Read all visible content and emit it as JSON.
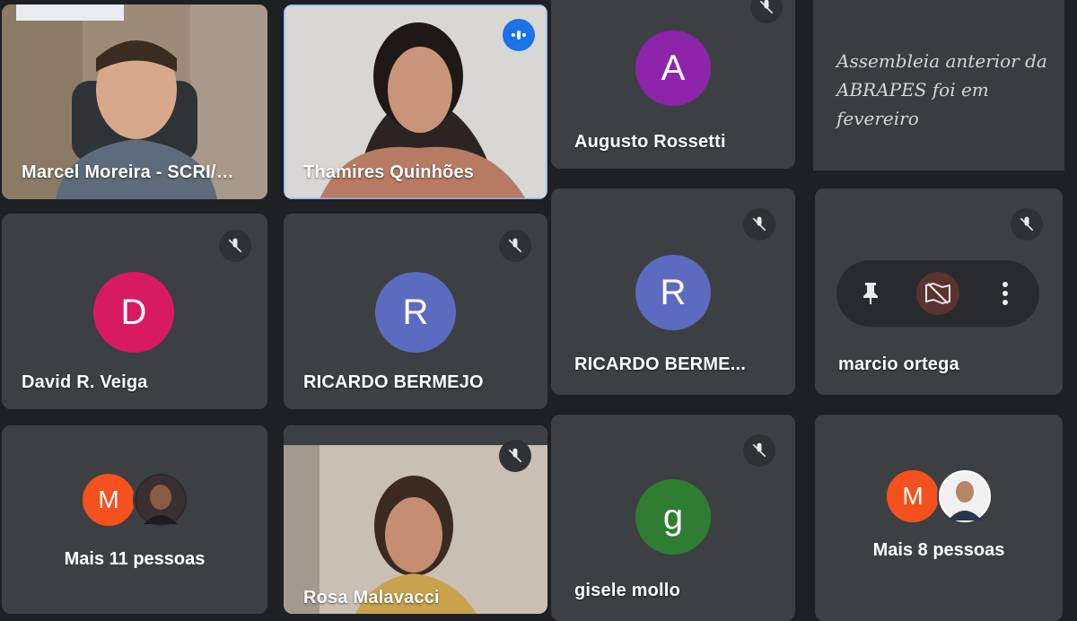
{
  "participants": [
    {
      "name": "Marcel Moreira - SCRI/M...",
      "type": "video"
    },
    {
      "name": "Thamires Quinhões",
      "type": "video",
      "speaking": true
    },
    {
      "name": "Augusto Rossetti",
      "initial": "A",
      "color": "#8e24aa"
    },
    {
      "name": "David R. Veiga",
      "initial": "D",
      "color": "#d81b60"
    },
    {
      "name": "RICARDO BERMEJO",
      "initial": "R",
      "color": "#5c6bc0"
    },
    {
      "name": "RICARDO BERME...",
      "initial": "R",
      "color": "#5c6bc0"
    },
    {
      "name": "marcio ortega"
    },
    {
      "name": "Rosa Malavacci",
      "type": "video"
    },
    {
      "name": "gisele mollo",
      "initial": "g",
      "color": "#2e7d32"
    }
  ],
  "others": [
    {
      "label": "Mais 11 pessoas",
      "initial": "M",
      "color": "#f4511e"
    },
    {
      "label": "Mais 8 pessoas",
      "initial": "M",
      "color": "#f4511e"
    }
  ],
  "caption": "Assembleia anterior da ABRAPES foi em fevereiro",
  "icons": {
    "muted": "mic-off-icon",
    "speaking": "audio-level-icon",
    "pin": "pin-icon",
    "remove": "remove-icon",
    "more": "more-vert-icon"
  }
}
